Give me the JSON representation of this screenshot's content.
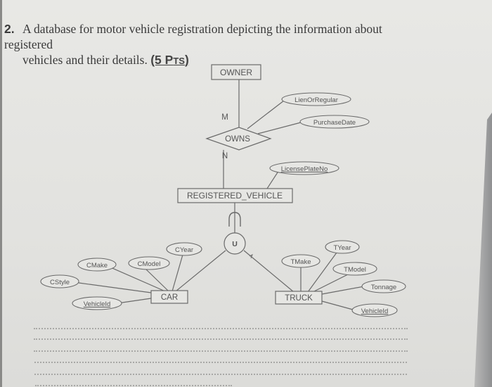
{
  "question": {
    "number": "2.",
    "text_line1": "A database for motor vehicle registration depicting the information about registered",
    "text_line2": "vehicles and their details.",
    "points_label_prefix": "(5 P",
    "points_label_sc": "TS",
    "points_label_suffix": ")"
  },
  "diagram": {
    "entities": {
      "owner": "OWNER",
      "registered_vehicle": "REGISTERED_VEHICLE",
      "car": "CAR",
      "truck": "TRUCK"
    },
    "relationships": {
      "owns": "OWNS"
    },
    "cardinalities": {
      "owner_side": "M",
      "vehicle_side": "N"
    },
    "specialization": {
      "symbol": "U",
      "subset_symbol": "⊂"
    },
    "attributes": {
      "lien_or_regular": "LienOrRegular",
      "purchase_date": "PurchaseDate",
      "license_plate_no": "LicensePlateNo",
      "cyear": "CYear",
      "cmake": "CMake",
      "cmodel": "CModel",
      "cstyle": "CStyle",
      "car_vehicle_id": "VehicleId",
      "tyear": "TYear",
      "tmake": "TMake",
      "tmodel": "TModel",
      "tonnage": "Tonnage",
      "truck_vehicle_id": "VehicleId"
    }
  },
  "answer_lines_count": 6
}
